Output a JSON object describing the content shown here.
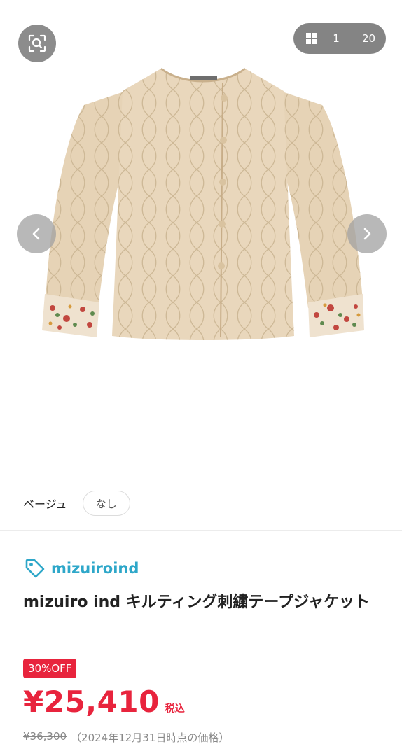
{
  "gallery": {
    "current": "1",
    "total": "20",
    "icons": {
      "lens": "image-search-icon",
      "grid": "grid-icon",
      "prev": "chevron-left-icon",
      "next": "chevron-right-icon"
    }
  },
  "variant": {
    "color_label": "ベージュ",
    "size_chip": "なし"
  },
  "product": {
    "brand": "mizuiroind",
    "brand_icon": "price-tag-icon",
    "title": "mizuiro ind キルティング刺繍テープジャケット",
    "discount_badge": "30%OFF",
    "price": "¥25,410",
    "tax_label": "税込",
    "original_price": "¥36,300",
    "price_note": "（2024年12月31日時点の価格）"
  },
  "colors": {
    "accent_red": "#e8243d",
    "brand_blue": "#2ea7c9",
    "jacket_beige": "#e6d3b6"
  }
}
